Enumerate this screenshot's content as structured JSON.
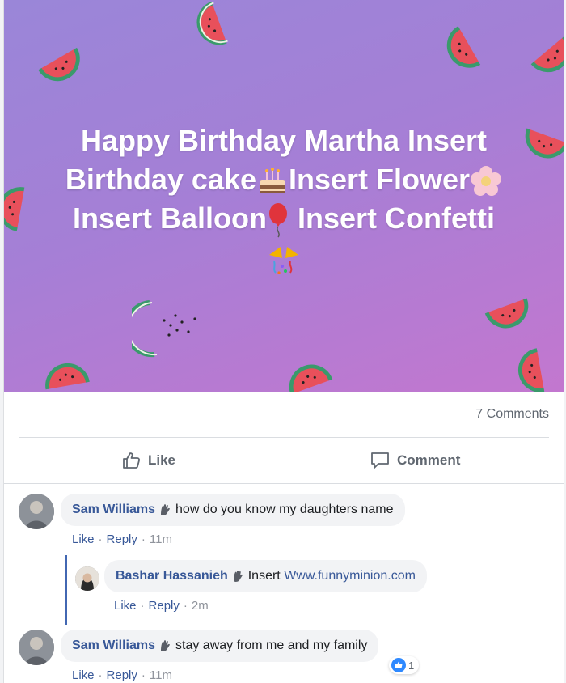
{
  "post": {
    "greeting_lines": [
      {
        "text": "Happy Birthday Martha Insert",
        "emoji": ""
      },
      {
        "text": "Birthday cake",
        "emoji": "cake",
        "after": "Insert Flower",
        "emoji2": "flower"
      },
      {
        "text": "Insert Balloon",
        "emoji": "balloon",
        "after": "Insert Confetti"
      }
    ],
    "line1": "Happy Birthday Martha Insert",
    "line2a": "Birthday cake",
    "line2b": "Insert Flower",
    "line3a": "Insert Balloon",
    "line3b": "Insert Confetti",
    "banner_colors": {
      "start": "#9a86d8",
      "end": "#c377cf"
    }
  },
  "stats": {
    "comments_count": "7 Comments"
  },
  "actions": {
    "like_label": "Like",
    "comment_label": "Comment"
  },
  "comments": [
    {
      "author": "Sam Williams",
      "text": "how do you know my daughters name",
      "like": "Like",
      "reply": "Reply",
      "time": "11m"
    },
    {
      "author": "Bashar Hassanieh",
      "text": "Insert",
      "link": "Www.funnyminion.com",
      "like": "Like",
      "reply": "Reply",
      "time": "2m"
    },
    {
      "author": "Sam Williams",
      "text": "stay away from me and my family",
      "like": "Like",
      "reply": "Reply",
      "time": "11m",
      "reaction_count": "1"
    }
  ],
  "colors": {
    "link": "#385898",
    "thread": "#4267b2",
    "bubble": "#f2f3f5"
  }
}
